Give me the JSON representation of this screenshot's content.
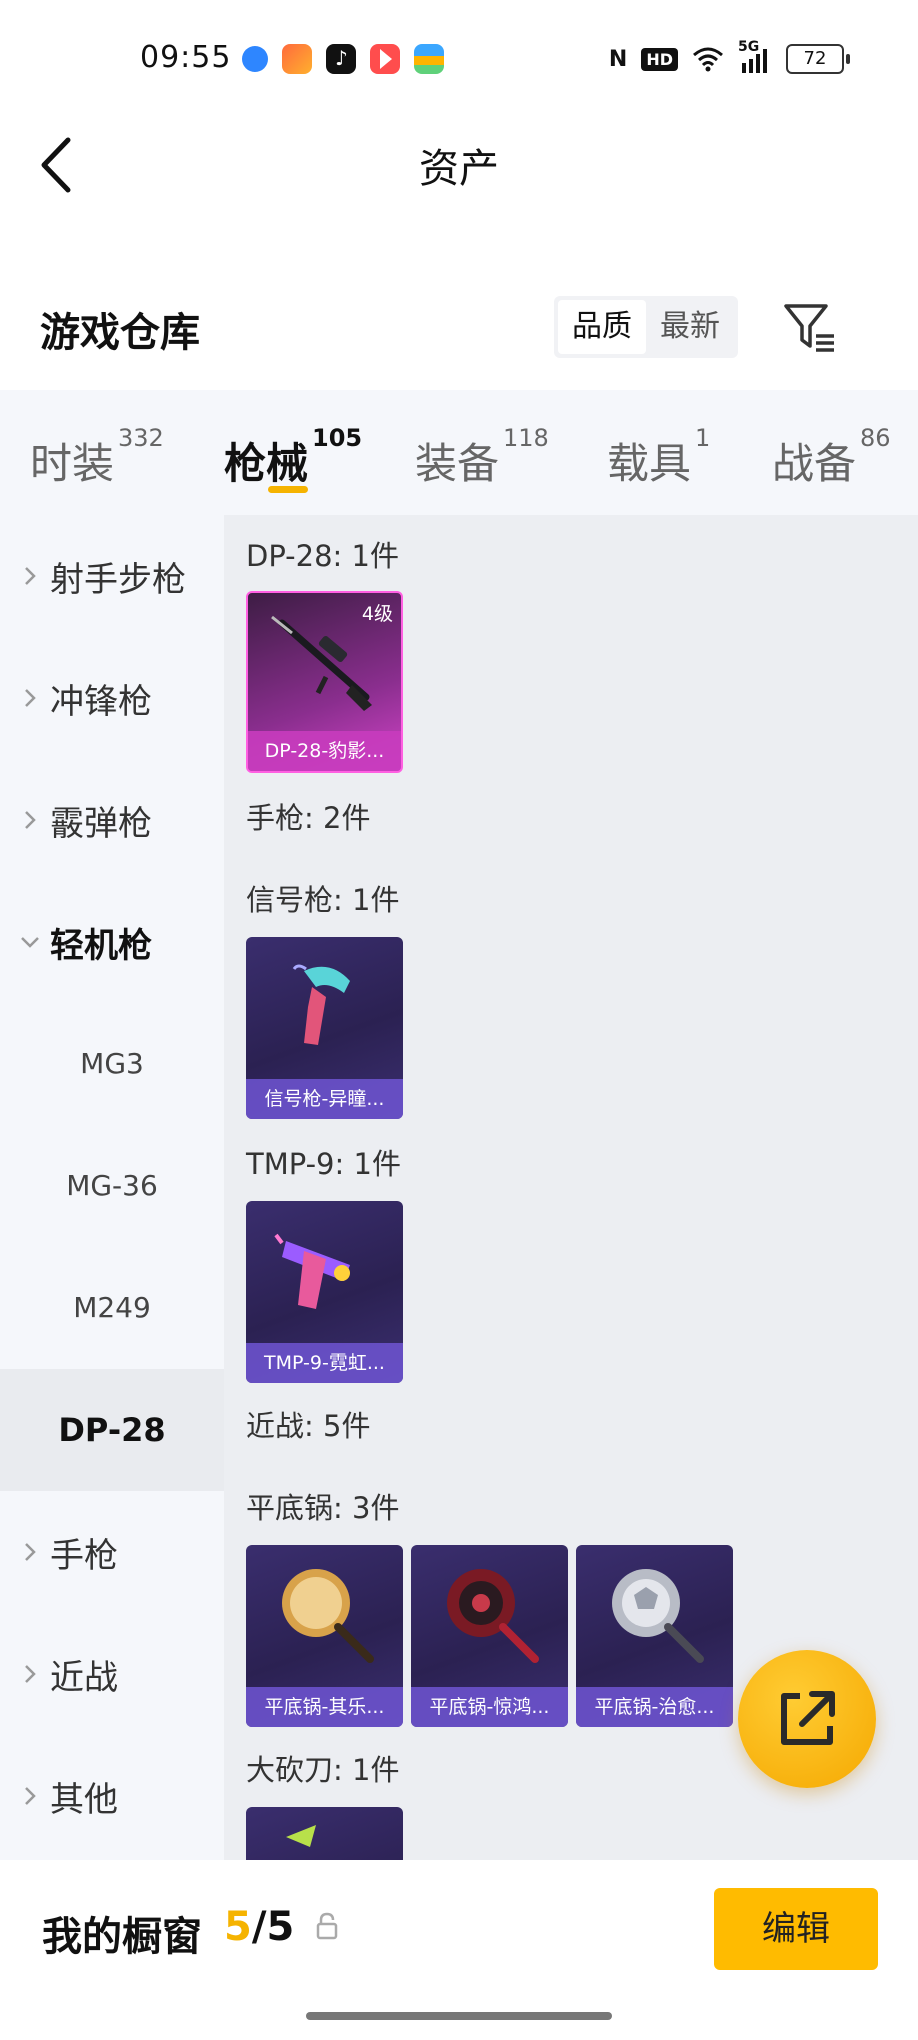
{
  "status_bar": {
    "time": "09:55",
    "app_icons": [
      {
        "name": "app-icon-blue",
        "color": "#2e86ff"
      },
      {
        "name": "app-icon-orange",
        "color": "#ff6a3d"
      },
      {
        "name": "tiktok-icon",
        "color": "#111111"
      },
      {
        "name": "video-app-icon",
        "color": "#ff4d4d"
      },
      {
        "name": "wallet-app-icon",
        "color": "#ffb400"
      }
    ],
    "nfc": "N",
    "hd": "HD",
    "network": "5G",
    "battery": "72"
  },
  "header": {
    "title": "资产"
  },
  "warehouse": {
    "title": "游戏仓库",
    "sort_options": [
      "品质",
      "最新"
    ],
    "active_sort": "品质"
  },
  "tabs": [
    {
      "label": "时装",
      "count": "332"
    },
    {
      "label": "枪械",
      "count": "105"
    },
    {
      "label": "装备",
      "count": "118"
    },
    {
      "label": "载具",
      "count": "1"
    },
    {
      "label": "战备",
      "count": "86"
    }
  ],
  "active_tab": "枪械",
  "sidebar": {
    "categories": [
      "射手步枪",
      "冲锋枪",
      "霰弹枪",
      "轻机枪",
      "手枪",
      "近战",
      "其他"
    ],
    "expanded": "轻机枪",
    "sub_items": [
      "MG3",
      "MG-36",
      "M249",
      "DP-28"
    ],
    "active_sub": "DP-28"
  },
  "content": {
    "groups": {
      "dp28": {
        "label": "DP-28: 1件"
      },
      "pistol": {
        "label": "手枪: 2件"
      },
      "flare": {
        "label": "信号枪: 1件"
      },
      "tmp9": {
        "label": "TMP-9: 1件"
      },
      "melee": {
        "label": "近战: 5件"
      },
      "pan": {
        "label": "平底锅: 3件"
      },
      "machete": {
        "label": "大砍刀: 1件"
      }
    },
    "cards": {
      "dp28": {
        "name": "DP-28-豹影...",
        "level": "4级"
      },
      "flare": {
        "name": "信号枪-异瞳..."
      },
      "tmp9": {
        "name": "TMP-9-霓虹..."
      },
      "pan1": {
        "name": "平底锅-其乐..."
      },
      "pan2": {
        "name": "平底锅-惊鸿..."
      },
      "pan3": {
        "name": "平底锅-治愈..."
      }
    }
  },
  "showcase": {
    "title": "我的橱窗",
    "current": "5",
    "total": "/5"
  },
  "edit_button": "编辑",
  "colors": {
    "accent": "#ffbb00",
    "card_purple": "#2b2152",
    "card_pink": "#d144c7"
  }
}
